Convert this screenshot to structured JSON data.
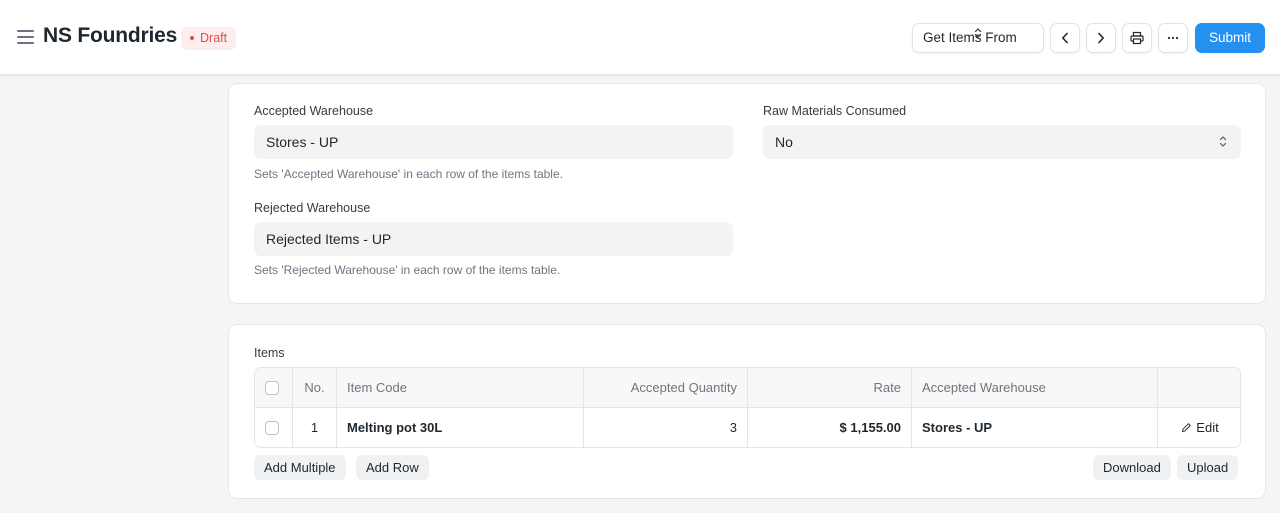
{
  "header": {
    "title": "NS Foundries",
    "status": "Draft",
    "get_items_label": "Get Items From",
    "submit_label": "Submit"
  },
  "warehouse_section": {
    "accepted_warehouse": {
      "label": "Accepted Warehouse",
      "value": "Stores - UP",
      "help": "Sets 'Accepted Warehouse' in each row of the items table."
    },
    "raw_materials_consumed": {
      "label": "Raw Materials Consumed",
      "value": "No"
    },
    "rejected_warehouse": {
      "label": "Rejected Warehouse",
      "value": "Rejected Items - UP",
      "help": "Sets 'Rejected Warehouse' in each row of the items table."
    }
  },
  "items_section": {
    "label": "Items",
    "columns": {
      "no": "No.",
      "item_code": "Item Code",
      "accepted_quantity": "Accepted Quantity",
      "rate": "Rate",
      "accepted_warehouse": "Accepted Warehouse"
    },
    "rows": [
      {
        "no": "1",
        "item_code": "Melting pot 30L",
        "accepted_quantity": "3",
        "rate": "$ 1,155.00",
        "accepted_warehouse": "Stores - UP",
        "edit_label": "Edit"
      }
    ],
    "add_multiple_label": "Add Multiple",
    "add_row_label": "Add Row",
    "download_label": "Download",
    "upload_label": "Upload"
  },
  "colors": {
    "primary": "#2490ef",
    "draft_text": "#e24c4c",
    "draft_bg": "#fdeded"
  }
}
